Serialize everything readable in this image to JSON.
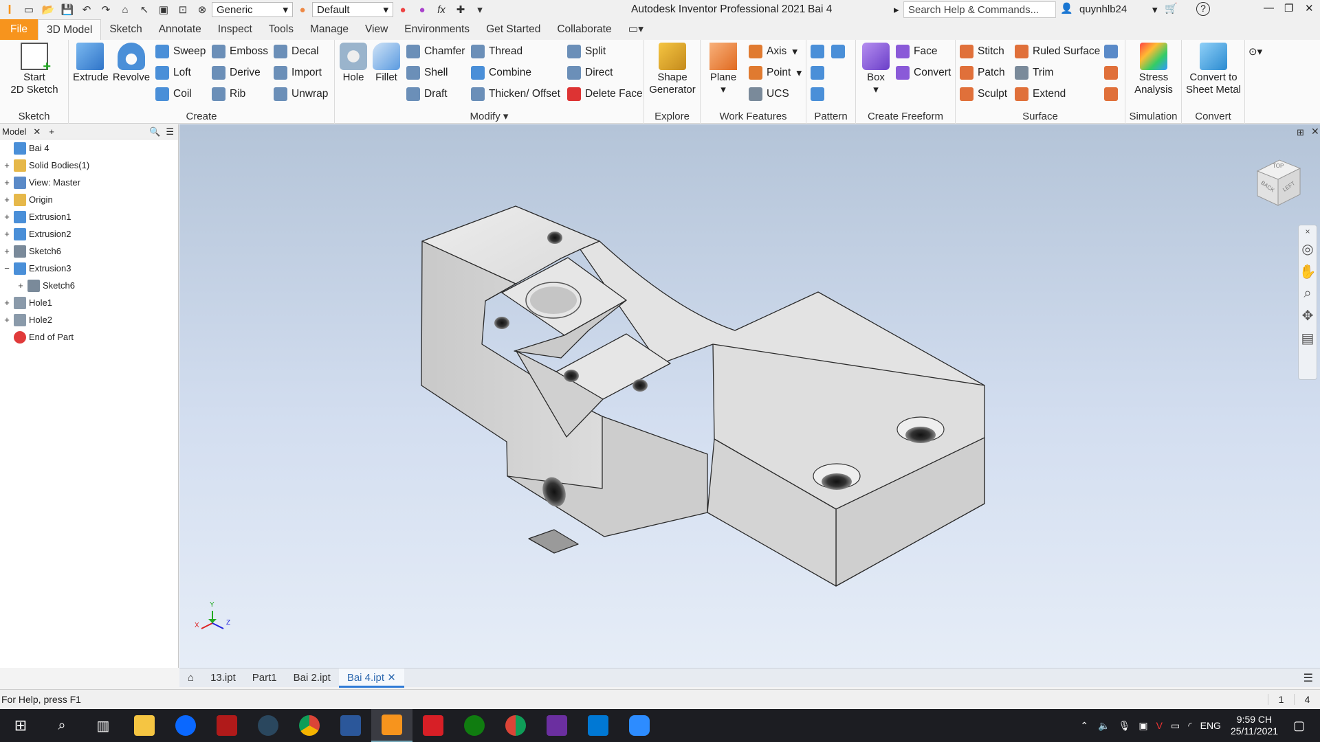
{
  "titlebar": {
    "app_title": "Autodesk Inventor Professional 2021",
    "doc_name": "Bai 4",
    "search_placeholder": "Search Help & Commands...",
    "user": "quynhlb24",
    "appearance": "Generic",
    "material": "Default",
    "help": "?"
  },
  "tabs": [
    "File",
    "3D Model",
    "Sketch",
    "Annotate",
    "Inspect",
    "Tools",
    "Manage",
    "View",
    "Environments",
    "Get Started",
    "Collaborate"
  ],
  "ribbon": {
    "sketch": {
      "label": "Sketch",
      "start": "Start",
      "start2": "2D Sketch"
    },
    "create": {
      "label": "Create",
      "extrude": "Extrude",
      "revolve": "Revolve",
      "sweep": "Sweep",
      "loft": "Loft",
      "coil": "Coil",
      "emboss": "Emboss",
      "derive": "Derive",
      "rib": "Rib",
      "decal": "Decal",
      "import": "Import",
      "unwrap": "Unwrap"
    },
    "modify": {
      "label": "Modify",
      "hole": "Hole",
      "fillet": "Fillet",
      "chamfer": "Chamfer",
      "shell": "Shell",
      "draft": "Draft",
      "thread": "Thread",
      "combine": "Combine",
      "thicken": "Thicken/ Offset",
      "split": "Split",
      "direct": "Direct",
      "delete_face": "Delete Face"
    },
    "explore": {
      "label": "Explore",
      "shape": "Shape",
      "generator": "Generator"
    },
    "work": {
      "label": "Work Features",
      "plane": "Plane",
      "axis": "Axis",
      "point": "Point",
      "ucs": "UCS"
    },
    "pattern": {
      "label": "Pattern"
    },
    "freeform": {
      "label": "Create Freeform",
      "box": "Box",
      "face": "Face",
      "convert": "Convert"
    },
    "surface": {
      "label": "Surface",
      "stitch": "Stitch",
      "patch": "Patch",
      "sculpt": "Sculpt",
      "ruled": "Ruled Surface",
      "trim": "Trim",
      "extend": "Extend"
    },
    "simulation": {
      "label": "Simulation",
      "stress": "Stress",
      "analysis": "Analysis"
    },
    "convert": {
      "label": "Convert",
      "c1": "Convert to",
      "c2": "Sheet Metal"
    }
  },
  "browser": {
    "tab": "Model",
    "items": [
      {
        "label": "Bai 4",
        "pm": "",
        "indent": 0
      },
      {
        "label": "Solid Bodies(1)",
        "pm": "+",
        "indent": 0
      },
      {
        "label": "View: Master",
        "pm": "+",
        "indent": 0
      },
      {
        "label": "Origin",
        "pm": "+",
        "indent": 0
      },
      {
        "label": "Extrusion1",
        "pm": "+",
        "indent": 0
      },
      {
        "label": "Extrusion2",
        "pm": "+",
        "indent": 0
      },
      {
        "label": "Sketch6",
        "pm": "+",
        "indent": 0
      },
      {
        "label": "Extrusion3",
        "pm": "−",
        "indent": 0
      },
      {
        "label": "Sketch6",
        "pm": "+",
        "indent": 1
      },
      {
        "label": "Hole1",
        "pm": "+",
        "indent": 0
      },
      {
        "label": "Hole2",
        "pm": "+",
        "indent": 0
      },
      {
        "label": "End of Part",
        "pm": "",
        "indent": 0
      }
    ]
  },
  "viewcube": {
    "top": "TOP",
    "back": "BACK",
    "left": "LEFT"
  },
  "axes": {
    "x": "X",
    "y": "Y",
    "z": "Z"
  },
  "doctabs": [
    "13.ipt",
    "Part1",
    "Bai 2.ipt",
    "Bai 4.ipt"
  ],
  "status": {
    "help": "For Help, press F1",
    "n1": "1",
    "n2": "4"
  },
  "taskbar": {
    "lang": "ENG",
    "time": "9:59 CH",
    "date": "25/11/2021"
  },
  "colors": {
    "file_tab": "#f7941d",
    "accent": "#2f7bd6",
    "taskbar": "#1c1d22"
  }
}
